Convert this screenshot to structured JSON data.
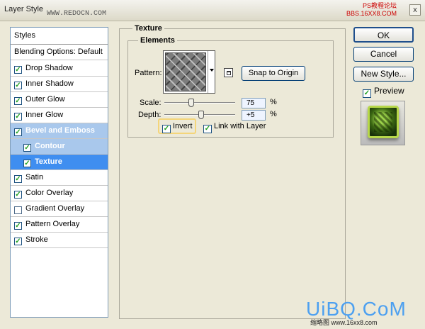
{
  "window": {
    "title": "Layer Style",
    "watermark_url": "WWW.REDOCN.COM",
    "watermark_right_1": "PS教程论坛",
    "watermark_right_2": "BBS.16XX8.COM",
    "close_label": "x"
  },
  "styles_list": {
    "header": "Styles",
    "blending": "Blending Options: Default",
    "items": [
      {
        "label": "Drop Shadow",
        "checked": true
      },
      {
        "label": "Inner Shadow",
        "checked": true
      },
      {
        "label": "Outer Glow",
        "checked": true
      },
      {
        "label": "Inner Glow",
        "checked": true
      },
      {
        "label": "Bevel and Emboss",
        "checked": true,
        "selected": "parent"
      },
      {
        "label": "Contour",
        "checked": true,
        "indent": true,
        "selected": "child"
      },
      {
        "label": "Texture",
        "checked": true,
        "indent": true,
        "selected": "active"
      },
      {
        "label": "Satin",
        "checked": true
      },
      {
        "label": "Color Overlay",
        "checked": true
      },
      {
        "label": "Gradient Overlay",
        "checked": false
      },
      {
        "label": "Pattern Overlay",
        "checked": true
      },
      {
        "label": "Stroke",
        "checked": true
      }
    ]
  },
  "texture": {
    "section_title": "Texture",
    "elements_title": "Elements",
    "pattern_label": "Pattern:",
    "snap_button": "Snap to Origin",
    "scale_label": "Scale:",
    "scale_value": "75",
    "scale_unit": "%",
    "scale_level": 0.37,
    "depth_label": "Depth:",
    "depth_value": "+5",
    "depth_unit": "%",
    "depth_level": 0.52,
    "invert_label": "Invert",
    "invert_checked": true,
    "link_label": "Link with Layer",
    "link_checked": true
  },
  "buttons": {
    "ok": "OK",
    "cancel": "Cancel",
    "new_style": "New Style..."
  },
  "preview": {
    "label": "Preview",
    "checked": true
  },
  "watermark_bottom": {
    "brand": "UiBQ.CoM",
    "sub": "缩略图 www.16xx8.com"
  },
  "colors": {
    "selected_active": "#3f8ef0",
    "selected_group": "#a9c8ec",
    "check_mark": "#21a121",
    "watermark": "#4da0f0"
  }
}
